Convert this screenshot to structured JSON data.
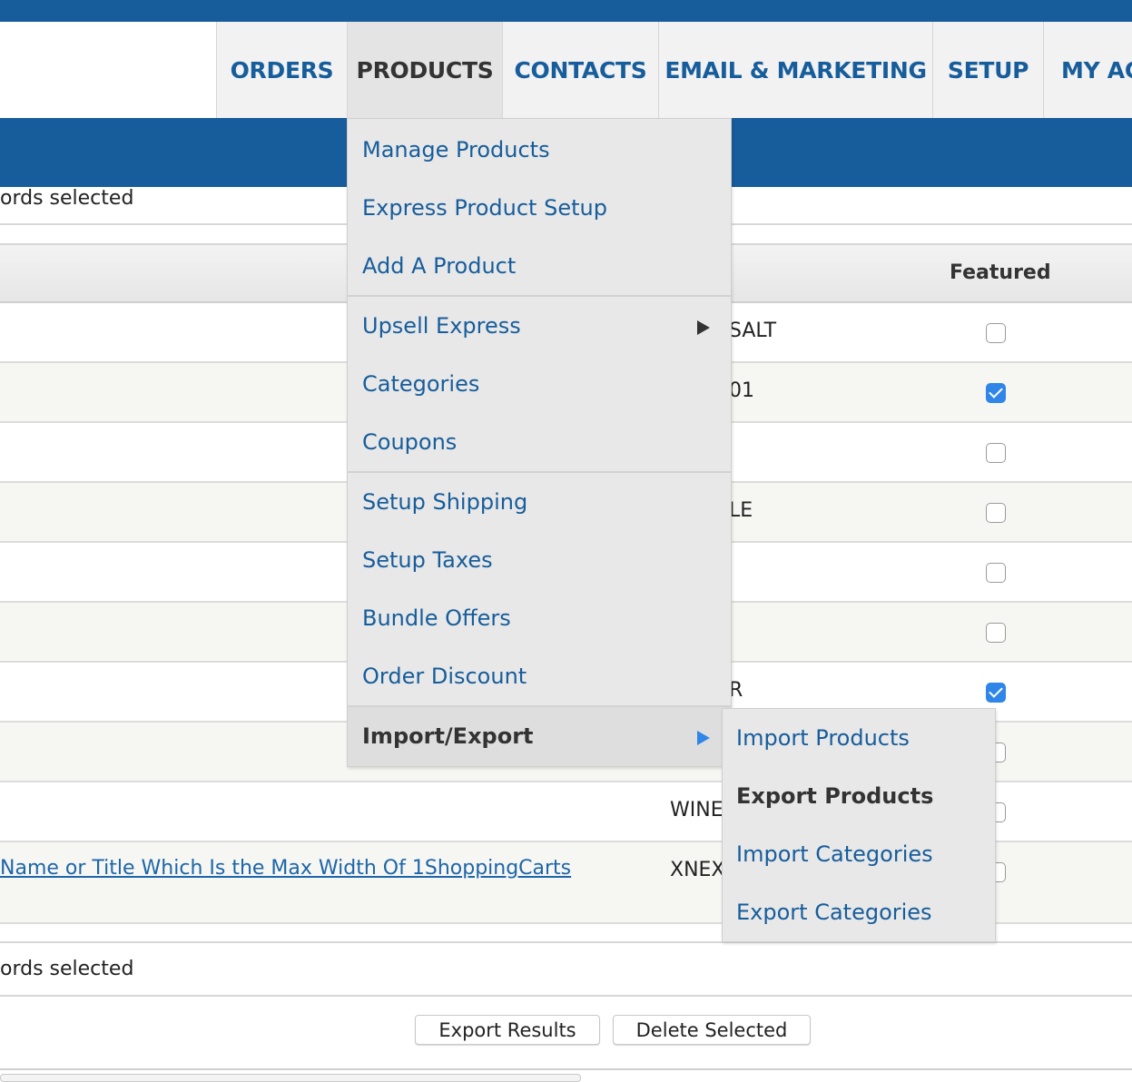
{
  "nav": {
    "tabs": [
      {
        "label": "ORDERS"
      },
      {
        "label": "PRODUCTS"
      },
      {
        "label": "CONTACTS"
      },
      {
        "label": "EMAIL & MARKETING"
      },
      {
        "label": "SETUP"
      },
      {
        "label": "MY AC"
      }
    ],
    "active_tab": "PRODUCTS"
  },
  "selection": {
    "top_text": "ords selected",
    "bottom_text": "ords selected"
  },
  "table": {
    "featured_header": "Featured",
    "rows": [
      {
        "sku": "SALT",
        "featured": false
      },
      {
        "sku": "01",
        "featured": true
      },
      {
        "sku": "",
        "featured": false
      },
      {
        "sku": "LE",
        "featured": false
      },
      {
        "sku": "",
        "featured": false
      },
      {
        "sku": "",
        "featured": false
      },
      {
        "sku": "R",
        "featured": true
      },
      {
        "sku": "",
        "featured": false
      },
      {
        "sku": "WINE",
        "featured": false
      },
      {
        "name_link": "Name or Title Which Is the Max Width Of 1ShoppingCarts",
        "sku": "XNEX",
        "featured": false
      }
    ]
  },
  "products_menu": {
    "items": [
      {
        "label": "Manage Products"
      },
      {
        "label": "Express Product Setup"
      },
      {
        "label": "Add A Product"
      },
      {
        "label": "Upsell Express",
        "has_submenu": true
      },
      {
        "label": "Categories"
      },
      {
        "label": "Coupons"
      },
      {
        "label": "Setup Shipping"
      },
      {
        "label": "Setup Taxes"
      },
      {
        "label": "Bundle Offers"
      },
      {
        "label": "Order Discount"
      },
      {
        "label": "Import/Export",
        "has_submenu": true,
        "highlighted": true
      }
    ]
  },
  "import_export_submenu": {
    "items": [
      {
        "label": "Import Products"
      },
      {
        "label": "Export Products",
        "highlighted": true
      },
      {
        "label": "Import Categories"
      },
      {
        "label": "Export Categories"
      }
    ]
  },
  "footer": {
    "export_button": "Export Results",
    "delete_button": "Delete Selected"
  },
  "colors": {
    "brand_blue": "#175d9b",
    "link_blue": "#1d66a8",
    "checkbox_checked": "#2f86e8"
  }
}
